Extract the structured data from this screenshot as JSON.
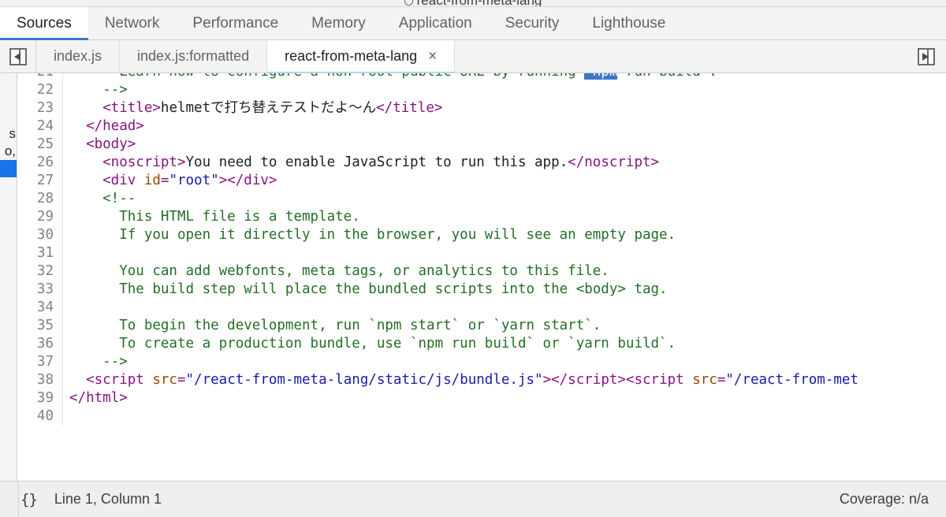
{
  "browser": {
    "page_title": "react-from-meta-lang",
    "favicon": "globe-icon"
  },
  "devtools_tabs": [
    {
      "label": "Sources",
      "active": true
    },
    {
      "label": "Network",
      "active": false
    },
    {
      "label": "Performance",
      "active": false
    },
    {
      "label": "Memory",
      "active": false
    },
    {
      "label": "Application",
      "active": false
    },
    {
      "label": "Security",
      "active": false
    },
    {
      "label": "Lighthouse",
      "active": false
    }
  ],
  "file_tabs": {
    "navigator_toggle": "show-navigator-icon",
    "next_tab_button": "next-tab-icon",
    "items": [
      {
        "label": "index.js",
        "active": false,
        "closable": false
      },
      {
        "label": "index.js:formatted",
        "active": false,
        "closable": false
      },
      {
        "label": "react-from-meta-lang",
        "active": true,
        "closable": true,
        "close_label": "×"
      }
    ]
  },
  "navigator_sliver": {
    "rows": [
      {
        "text": "",
        "selected": false
      },
      {
        "text": "",
        "selected": false
      },
      {
        "text": "",
        "selected": false
      },
      {
        "text": "s",
        "selected": false
      },
      {
        "text": "o,",
        "selected": false
      },
      {
        "text": "",
        "selected": true
      },
      {
        "text": "",
        "selected": false
      }
    ]
  },
  "editor": {
    "first_visible_line": 21,
    "lines": [
      {
        "num": "21",
        "tokens": [
          {
            "text": "      Learn how to configure a non-root public URL by running ",
            "cls": "t-comment"
          },
          {
            "text": "`npm",
            "cls": "t-sel"
          },
          {
            "text": " run build`.",
            "cls": "t-comment"
          }
        ]
      },
      {
        "num": "22",
        "tokens": [
          {
            "text": "    -->",
            "cls": "t-comment"
          }
        ]
      },
      {
        "num": "23",
        "tokens": [
          {
            "text": "    <title>",
            "cls": "t-tag"
          },
          {
            "text": "helmetで打ち替えテストだよ〜ん",
            "cls": "t-text"
          },
          {
            "text": "</title>",
            "cls": "t-tag"
          }
        ]
      },
      {
        "num": "24",
        "tokens": [
          {
            "text": "  </head>",
            "cls": "t-tag"
          }
        ]
      },
      {
        "num": "25",
        "tokens": [
          {
            "text": "  <body>",
            "cls": "t-tag"
          }
        ]
      },
      {
        "num": "26",
        "tokens": [
          {
            "text": "    <noscript>",
            "cls": "t-tag"
          },
          {
            "text": "You need to enable JavaScript to run this app.",
            "cls": "t-text"
          },
          {
            "text": "</noscript>",
            "cls": "t-tag"
          }
        ]
      },
      {
        "num": "27",
        "tokens": [
          {
            "text": "    <div ",
            "cls": "t-tag"
          },
          {
            "text": "id",
            "cls": "t-attr"
          },
          {
            "text": "=",
            "cls": "t-tag"
          },
          {
            "text": "\"root\"",
            "cls": "t-val"
          },
          {
            "text": "></div>",
            "cls": "t-tag"
          }
        ]
      },
      {
        "num": "28",
        "tokens": [
          {
            "text": "    <!--",
            "cls": "t-comment"
          }
        ]
      },
      {
        "num": "29",
        "tokens": [
          {
            "text": "      This HTML file is a template.",
            "cls": "t-comment"
          }
        ]
      },
      {
        "num": "30",
        "tokens": [
          {
            "text": "      If you open it directly in the browser, you will see an empty page.",
            "cls": "t-comment"
          }
        ]
      },
      {
        "num": "31",
        "tokens": [
          {
            "text": "",
            "cls": "t-comment"
          }
        ]
      },
      {
        "num": "32",
        "tokens": [
          {
            "text": "      You can add webfonts, meta tags, or analytics to this file.",
            "cls": "t-comment"
          }
        ]
      },
      {
        "num": "33",
        "tokens": [
          {
            "text": "      The build step will place the bundled scripts into the <body> tag.",
            "cls": "t-comment"
          }
        ]
      },
      {
        "num": "34",
        "tokens": [
          {
            "text": "",
            "cls": "t-comment"
          }
        ]
      },
      {
        "num": "35",
        "tokens": [
          {
            "text": "      To begin the development, run `npm start` or `yarn start`.",
            "cls": "t-comment"
          }
        ]
      },
      {
        "num": "36",
        "tokens": [
          {
            "text": "      To create a production bundle, use `npm run build` or `yarn build`.",
            "cls": "t-comment"
          }
        ]
      },
      {
        "num": "37",
        "tokens": [
          {
            "text": "    -->",
            "cls": "t-comment"
          }
        ]
      },
      {
        "num": "38",
        "tokens": [
          {
            "text": "  <script ",
            "cls": "t-tag"
          },
          {
            "text": "src",
            "cls": "t-attr"
          },
          {
            "text": "=",
            "cls": "t-tag"
          },
          {
            "text": "\"/react-from-meta-lang/static/js/bundle.js\"",
            "cls": "t-val"
          },
          {
            "text": "></script><script ",
            "cls": "t-tag"
          },
          {
            "text": "src",
            "cls": "t-attr"
          },
          {
            "text": "=",
            "cls": "t-tag"
          },
          {
            "text": "\"/react-from-met",
            "cls": "t-val"
          }
        ]
      },
      {
        "num": "39",
        "tokens": [
          {
            "text": "</html>",
            "cls": "t-tag"
          }
        ]
      },
      {
        "num": "40",
        "tokens": [
          {
            "text": "",
            "cls": "t-text"
          }
        ]
      }
    ]
  },
  "statusbar": {
    "pretty_print_label": "{}",
    "cursor_position": "Line 1, Column 1",
    "coverage": "Coverage: n/a"
  },
  "colors": {
    "accent_blue": "#3b78c4",
    "selection_blue": "#1a73e8",
    "tag_purple": "#881280",
    "attr_orange": "#994500",
    "value_blue": "#1a1aa6",
    "comment_green": "#236e25",
    "chrome_bg": "#f3f3f3"
  }
}
